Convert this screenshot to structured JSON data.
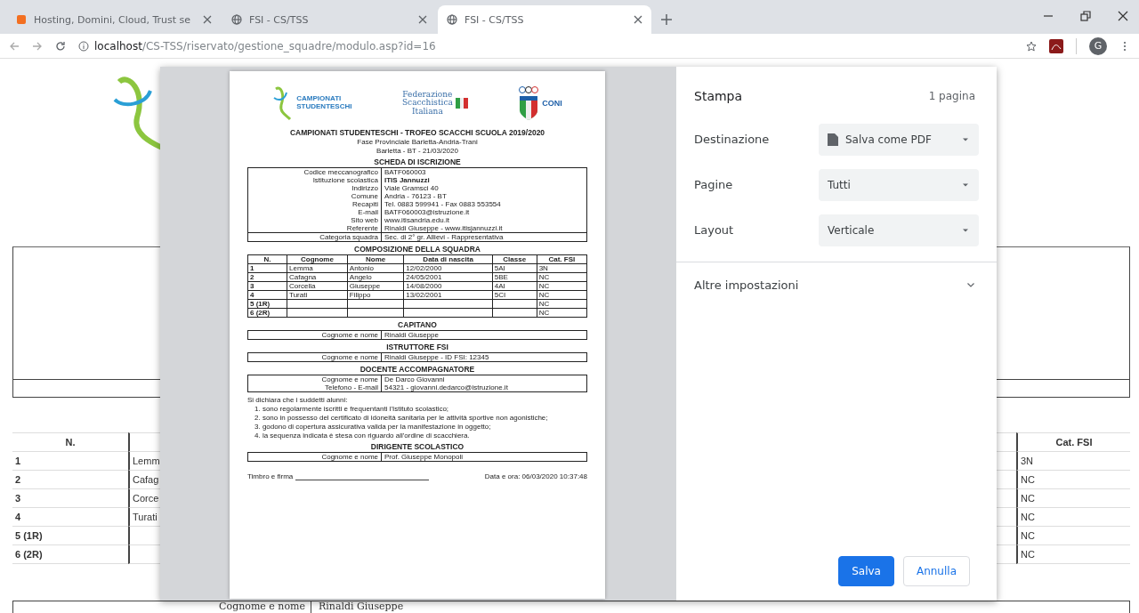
{
  "browser": {
    "tabs": [
      {
        "title": "Hosting, Domini, Cloud, Trust se",
        "kind": "site",
        "selected": false
      },
      {
        "title": "FSI - CS/TSS",
        "kind": "globe",
        "selected": false
      },
      {
        "title": "FSI - CS/TSS",
        "kind": "globe",
        "selected": true
      }
    ],
    "address": {
      "host": "localhost",
      "path": "/CS-TSS/riservato/gestione_squadre/modulo.asp?id=16"
    },
    "profile_initial": "G"
  },
  "background_page": {
    "table": {
      "columns": [
        "N.",
        "Cat. FSI"
      ],
      "rows": [
        {
          "n": "1",
          "surname": "Lemm",
          "cat": "3N"
        },
        {
          "n": "2",
          "surname": "Cafag",
          "cat": "NC"
        },
        {
          "n": "3",
          "surname": "Corce",
          "cat": "NC"
        },
        {
          "n": "4",
          "surname": "Turati",
          "cat": "NC"
        },
        {
          "n": "5 (1R)",
          "surname": "",
          "cat": "NC"
        },
        {
          "n": "6 (2R)",
          "surname": "",
          "cat": "NC"
        }
      ]
    },
    "footer": {
      "label": "Cognome e nome",
      "value": "Rinaldi Giuseppe"
    }
  },
  "preview": {
    "logos": {
      "campionati": [
        "CAMPIONATI",
        "STUDENTESCHI"
      ],
      "federazione": [
        "Federazione",
        "Scacchistica",
        "Italiana"
      ],
      "coni": "CONI"
    },
    "title": "CAMPIONATI STUDENTESCHI - TROFEO SCACCHI SCUOLA 2019/2020",
    "subtitle": "Fase Provinciale Barletta-Andria-Trani",
    "date_line": "Barletta - BT - 21/03/2020",
    "form_heading": "SCHEDA DI ISCRIZIONE",
    "school": [
      {
        "label": "Codice meccanografico",
        "value": "BATF060003",
        "bold": false
      },
      {
        "label": "Istituzione scolastica",
        "value": "ITIS Jannuzzi",
        "bold": true
      },
      {
        "label": "Indirizzo",
        "value": "Viale Gramsci 40",
        "bold": false
      },
      {
        "label": "Comune",
        "value": "Andria - 76123 - BT",
        "bold": false
      },
      {
        "label": "Recapiti",
        "value": "Tel. 0883 599941 - Fax 0883 553554",
        "bold": false
      },
      {
        "label": "E-mail",
        "value": "BATF060003@istruzione.it",
        "bold": false
      },
      {
        "label": "Sito web",
        "value": "www.itisandria.edu.it",
        "bold": false
      },
      {
        "label": "Referente",
        "value": "Rinaldi Giuseppe - www.itisjannuzzi.it",
        "bold": false
      }
    ],
    "category": {
      "label": "Categoria squadra",
      "value": "Sec. di 2° gr. Allievi - Rappresentativa"
    },
    "team_heading": "COMPOSIZIONE DELLA SQUADRA",
    "team_columns": [
      "N.",
      "Cognome",
      "Nome",
      "Data di nascita",
      "Classe",
      "Cat. FSI"
    ],
    "team_rows": [
      [
        "1",
        "Lemma",
        "Antonio",
        "12/02/2000",
        "5AI",
        "3N"
      ],
      [
        "2",
        "Cafagna",
        "Angelo",
        "24/05/2001",
        "5BE",
        "NC"
      ],
      [
        "3",
        "Corcella",
        "Giuseppe",
        "14/08/2000",
        "4AI",
        "NC"
      ],
      [
        "4",
        "Turati",
        "Filippo",
        "13/02/2001",
        "5CI",
        "NC"
      ],
      [
        "5 (1R)",
        "",
        "",
        "",
        "",
        "NC"
      ],
      [
        "6 (2R)",
        "",
        "",
        "",
        "",
        "NC"
      ]
    ],
    "sections": [
      {
        "heading": "CAPITANO",
        "rows": [
          {
            "label": "Cognome e nome",
            "value": "Rinaldi Giuseppe"
          }
        ]
      },
      {
        "heading": "ISTRUTTORE FSI",
        "rows": [
          {
            "label": "Cognome e nome",
            "value": "Rinaldi Giuseppe - ID FSI: 12345"
          }
        ]
      },
      {
        "heading": "DOCENTE ACCOMPAGNATORE",
        "rows": [
          {
            "label": "Cognome e nome",
            "value": "De Darco Giovanni"
          },
          {
            "label": "Telefono - E-mail",
            "value": "54321 - giovanni.dedarco@istruzione.it"
          }
        ]
      }
    ],
    "declaration": {
      "intro": "Si dichiara che i suddetti alunni:",
      "items": [
        "1. sono regolarmente iscritti e frequentanti l'Istituto scolastico;",
        "2. sono in possesso del certificato di idoneità sanitaria per le attività sportive non agonistiche;",
        "3. godono di copertura assicurativa valida per la manifestazione in oggetto;",
        "4. la sequenza indicata è stesa con riguardo all'ordine di scacchiera."
      ]
    },
    "principal": {
      "heading": "DIRIGENTE SCOLASTICO",
      "rows": [
        {
          "label": "Cognome e nome",
          "value": "Prof. Giuseppe Monopoli"
        }
      ]
    },
    "signature": "Timbro e firma",
    "timestamp": "Data e ora: 06/03/2020 10:37:48"
  },
  "print_settings": {
    "title": "Stampa",
    "pages_count": "1 pagina",
    "options": [
      {
        "label": "Destinazione",
        "value": "Salva come PDF",
        "kind": "destination"
      },
      {
        "label": "Pagine",
        "value": "Tutti",
        "kind": "plain"
      },
      {
        "label": "Layout",
        "value": "Verticale",
        "kind": "plain"
      }
    ],
    "more": {
      "label": "Altre impostazioni",
      "expanded": false
    },
    "buttons": [
      {
        "label": "Salva",
        "kind": "primary"
      },
      {
        "label": "Annulla",
        "kind": "secondary"
      }
    ]
  }
}
